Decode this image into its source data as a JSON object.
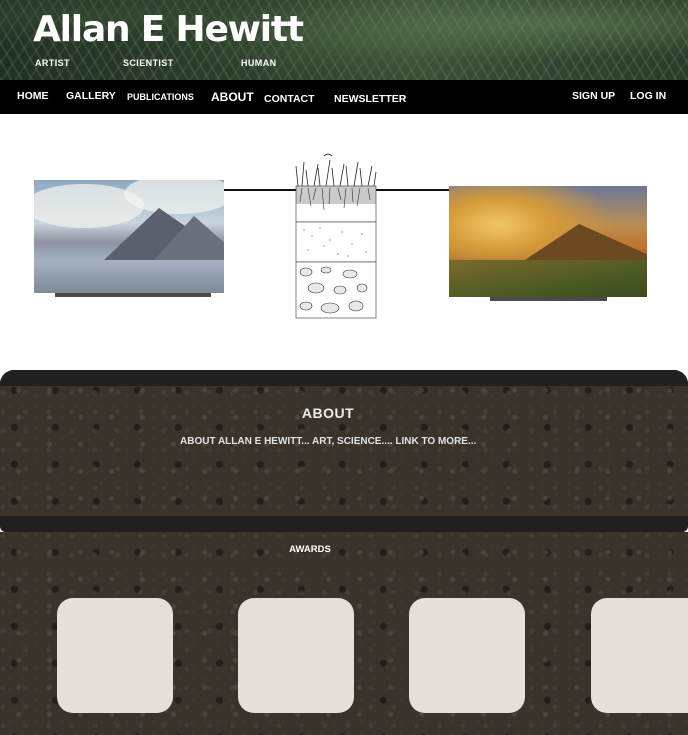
{
  "site": {
    "title": "Allan E Hewitt",
    "taglines": [
      "ARTIST",
      "SCIENTIST",
      "HUMAN"
    ]
  },
  "nav": {
    "items": [
      "HOME",
      "GALLERY",
      "PUBLICATIONS",
      "ABOUT",
      "CONTACT",
      "NEWSLETTER"
    ],
    "account": [
      "SIGN UP",
      "LOG IN"
    ]
  },
  "about": {
    "heading": "ABOUT",
    "text": "ABOUT ALLAN E HEWITT... ART, SCIENCE....  LINK TO MORE..."
  },
  "awards": {
    "heading": "AWARDS",
    "card_count": 4
  },
  "colors": {
    "nav_background": "#000000",
    "band": "#221f20",
    "card": "#e5dfd9",
    "soil": "#3a332c"
  },
  "images": {
    "left": "lake-mountain-painting",
    "center": "soil-profile-illustration",
    "right": "highland-landscape-painting",
    "hero": "fern-foliage-photo",
    "background": "soil-texture-photo"
  }
}
